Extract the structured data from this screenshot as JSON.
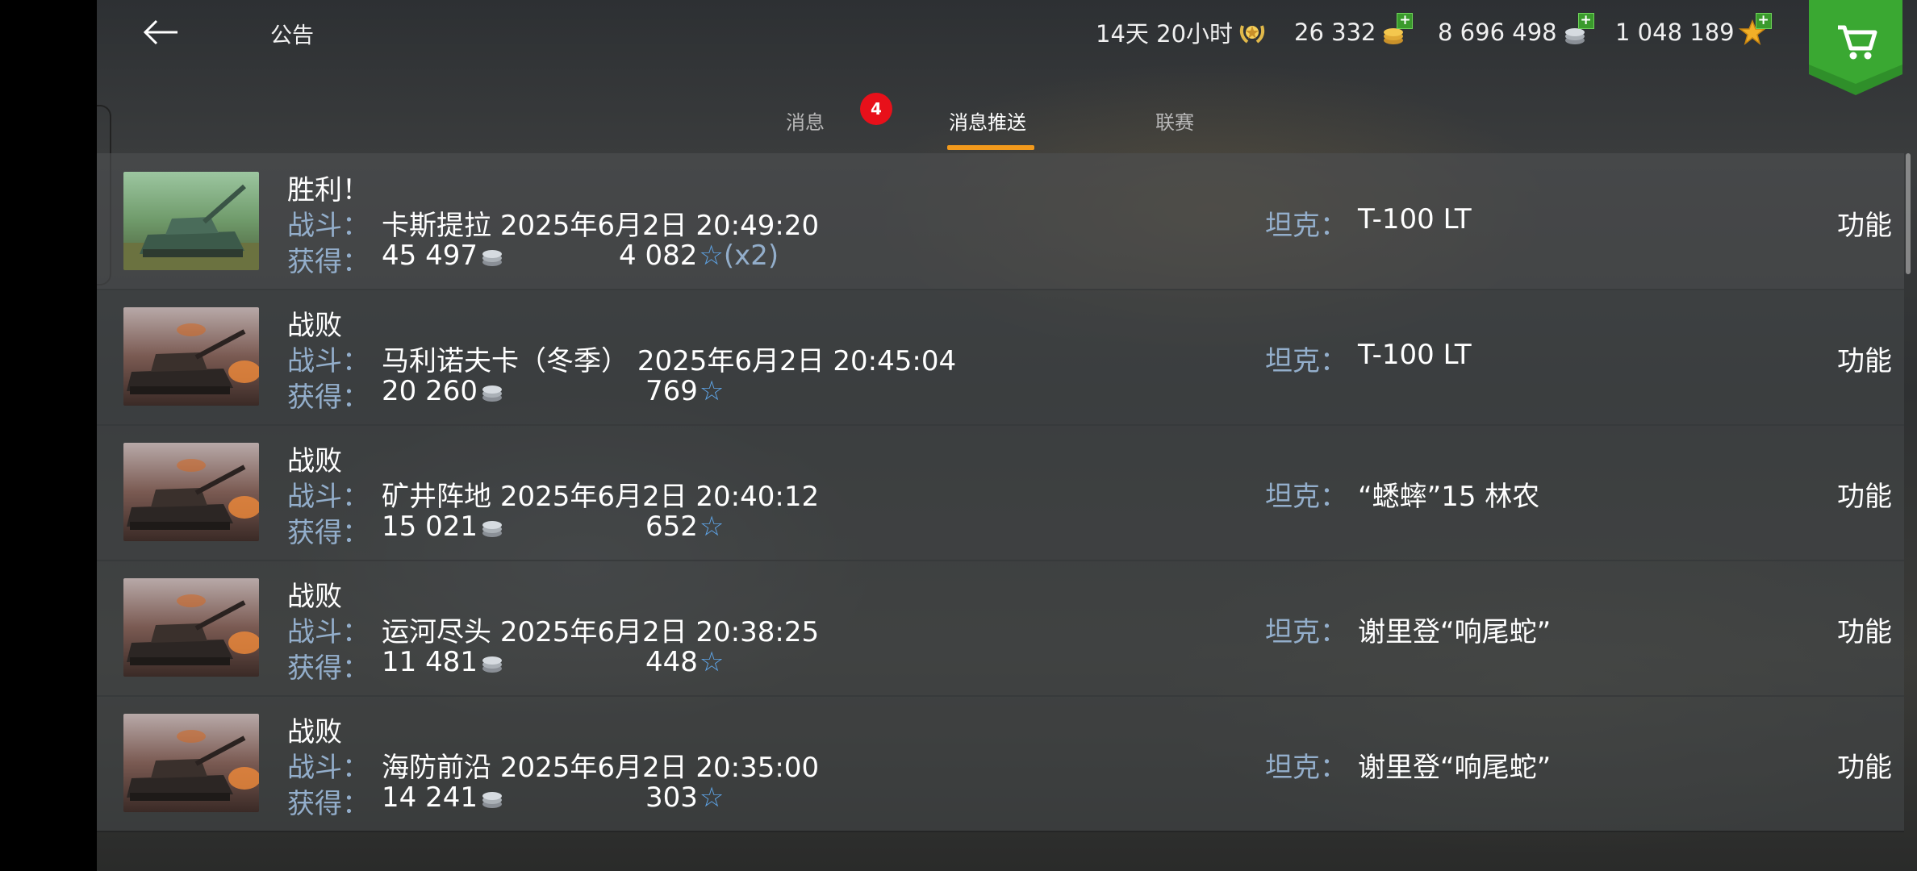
{
  "header": {
    "title": "公告",
    "premium_time": "14天 20小时",
    "gold": "26 332",
    "silver": "8 696 498",
    "free_xp": "1 048 189"
  },
  "tabs": [
    {
      "label": "消息",
      "badge": "4"
    },
    {
      "label": "消息推送",
      "active": true
    },
    {
      "label": "联赛"
    }
  ],
  "labels": {
    "battle": "战斗：",
    "earned": "获得：",
    "tank": "坦克：",
    "function": "功能"
  },
  "battles": [
    {
      "result": "胜利！",
      "map": "卡斯提拉",
      "time": "2025年6月2日 20:49:20",
      "silver": "45 497",
      "xp": "4 082",
      "xp_mult": "(x2)",
      "tank": "T-100 LT",
      "thumb": "victory"
    },
    {
      "result": "战败",
      "map": "马利诺夫卡（冬季）",
      "time": "2025年6月2日 20:45:04",
      "silver": "20 260",
      "xp": "769",
      "xp_mult": "",
      "tank": "T-100 LT",
      "thumb": "defeat"
    },
    {
      "result": "战败",
      "map": "矿井阵地",
      "time": "2025年6月2日 20:40:12",
      "silver": "15 021",
      "xp": "652",
      "xp_mult": "",
      "tank": "“蟋蟀”15 林农",
      "thumb": "defeat"
    },
    {
      "result": "战败",
      "map": "运河尽头",
      "time": "2025年6月2日 20:38:25",
      "silver": "11 481",
      "xp": "448",
      "xp_mult": "",
      "tank": "谢里登“响尾蛇”",
      "thumb": "defeat"
    },
    {
      "result": "战败",
      "map": "海防前沿",
      "time": "2025年6月2日 20:35:00",
      "silver": "14 241",
      "xp": "303",
      "xp_mult": "",
      "tank": "谢里登“响尾蛇”",
      "thumb": "defeat"
    }
  ],
  "colors": {
    "accent_tab": "#f39a1c",
    "badge": "#e8101a",
    "label": "#93aecb",
    "star": "#5ea4e6",
    "shop_green": "#2f8f2a"
  }
}
